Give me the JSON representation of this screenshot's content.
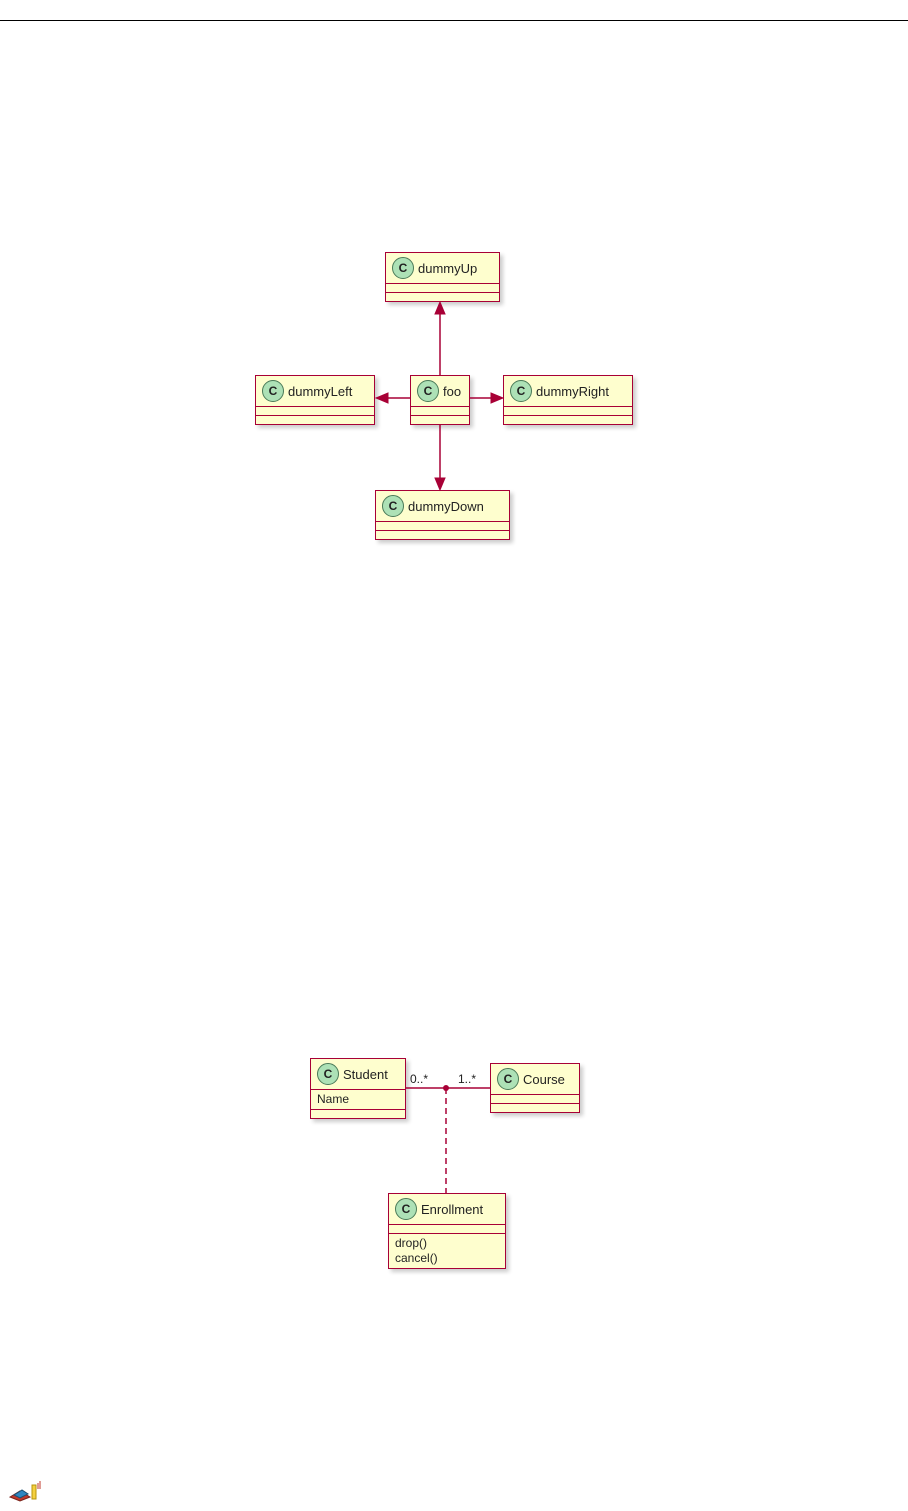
{
  "classBadge": "C",
  "diagram1": {
    "foo": "foo",
    "dummyUp": "dummyUp",
    "dummyDown": "dummyDown",
    "dummyLeft": "dummyLeft",
    "dummyRight": "dummyRight"
  },
  "diagram2": {
    "student": {
      "name": "Student",
      "attr1": "Name"
    },
    "course": {
      "name": "Course"
    },
    "enrollment": {
      "name": "Enrollment",
      "op1": "drop()",
      "op2": "cancel()"
    },
    "multLeft": "0..*",
    "multRight": "1..*"
  }
}
